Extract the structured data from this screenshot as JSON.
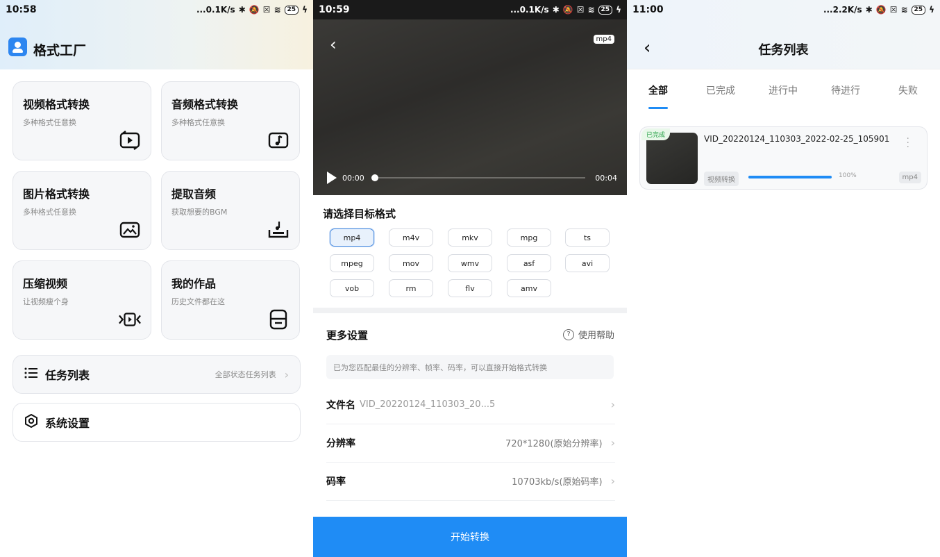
{
  "home": {
    "status": {
      "time": "10:58",
      "speed": "...0.1K/s",
      "battery": "25"
    },
    "app_title": "格式工厂",
    "cards": [
      {
        "title": "视频格式转换",
        "subtitle": "多种格式任意换",
        "icon": "video-convert-icon"
      },
      {
        "title": "音频格式转换",
        "subtitle": "多种格式任意换",
        "icon": "audio-convert-icon"
      },
      {
        "title": "图片格式转换",
        "subtitle": "多种格式任意换",
        "icon": "image-convert-icon"
      },
      {
        "title": "提取音频",
        "subtitle": "获取想要的BGM",
        "icon": "extract-audio-icon"
      },
      {
        "title": "压缩视频",
        "subtitle": "让视频瘦个身",
        "icon": "compress-video-icon"
      },
      {
        "title": "我的作品",
        "subtitle": "历史文件都在这",
        "icon": "my-works-icon"
      }
    ],
    "task_list": {
      "label": "任务列表",
      "hint": "全部状态任务列表"
    },
    "settings": {
      "label": "系统设置"
    }
  },
  "convert": {
    "status": {
      "time": "10:59",
      "speed": "...0.1K/s",
      "battery": "25"
    },
    "video": {
      "badge": "mp4",
      "current": "00:00",
      "total": "00:04"
    },
    "format_heading": "请选择目标格式",
    "formats": [
      "mp4",
      "m4v",
      "mkv",
      "mpg",
      "ts",
      "mpeg",
      "mov",
      "wmv",
      "asf",
      "avi",
      "vob",
      "rm",
      "flv",
      "amv"
    ],
    "selected_format": "mp4",
    "more_settings": "更多设置",
    "help": "使用帮助",
    "tip": "已为您匹配最佳的分辨率、帧率、码率，可以直接开始格式转换",
    "settings": [
      {
        "key": "文件名",
        "value": "VID_20220124_110303_20...5"
      },
      {
        "key": "分辨率",
        "value": "720*1280(原始分辨率)"
      },
      {
        "key": "码率",
        "value": "10703kb/s(原始码率)"
      }
    ],
    "start_button": "开始转换"
  },
  "tasks": {
    "status": {
      "time": "11:00",
      "speed": "...2.2K/s",
      "battery": "25"
    },
    "title": "任务列表",
    "tabs": [
      "全部",
      "已完成",
      "进行中",
      "待进行",
      "失败"
    ],
    "active_tab": "全部",
    "items": [
      {
        "state": "已完成",
        "name": "VID_20220124_110303_2022-02-25_105901",
        "type": "视频转换",
        "progress": 100,
        "progress_label": "100%",
        "format": "mp4"
      }
    ]
  }
}
